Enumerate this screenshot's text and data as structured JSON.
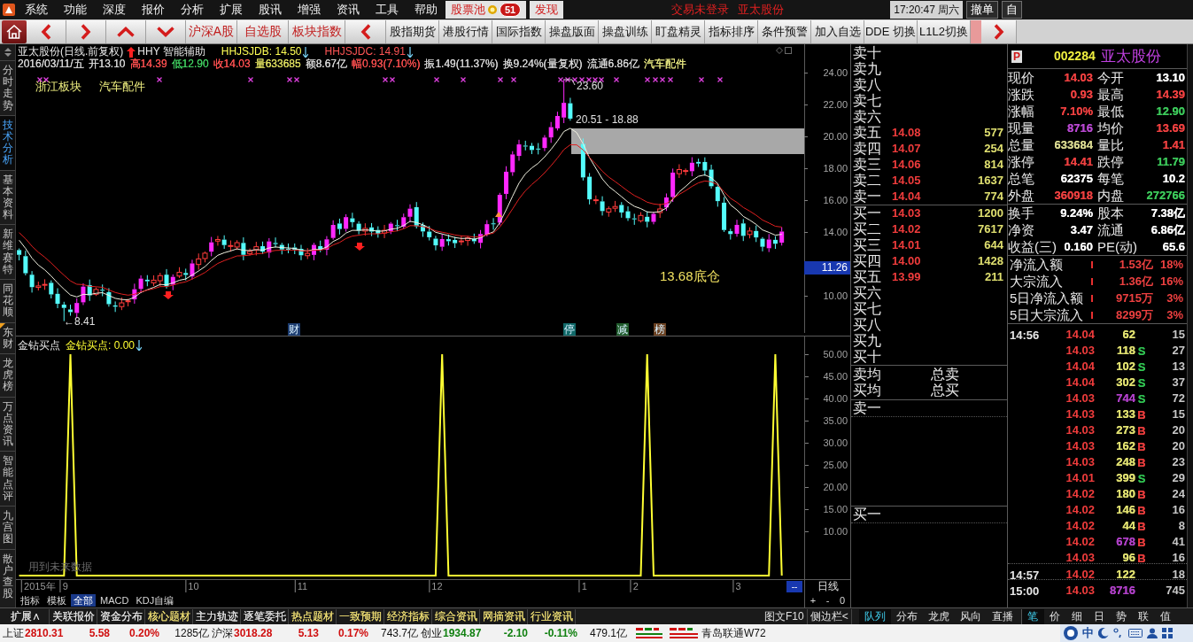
{
  "menu_bar": {
    "items": [
      "系统",
      "功能",
      "深度",
      "报价",
      "分析",
      "扩展",
      "股讯",
      "增强",
      "资讯",
      "工具",
      "帮助"
    ],
    "quick_buttons": [
      {
        "label": "股票池",
        "badge": "51"
      },
      {
        "label": "发现"
      }
    ],
    "notices": [
      "交易未登录",
      "亚太股份"
    ],
    "clock": "17:20:47 周六",
    "buttons": [
      "撤单",
      "自"
    ]
  },
  "toolbar": {
    "market_buttons": [
      "沪深A股",
      "自选股",
      "板块指数"
    ],
    "function_buttons": [
      "股指期货",
      "港股行情",
      "国际指数",
      "操盘版面",
      "操盘训练",
      "盯盘精灵",
      "指标排序",
      "条件预警",
      "加入自选",
      "DDE 切换",
      "L1L2切换"
    ]
  },
  "side_tabs": [
    {
      "label": "分时走势",
      "selected": false,
      "flagged": false
    },
    {
      "label": "技术分析",
      "selected": true,
      "flagged": false
    },
    {
      "label": "基本资料",
      "selected": false,
      "flagged": false
    },
    {
      "label": "新维赛特",
      "selected": false,
      "flagged": false
    },
    {
      "label": "同花顺",
      "selected": false,
      "flagged": false
    },
    {
      "label": "东财",
      "selected": false,
      "flagged": true
    },
    {
      "label": "龙虎榜",
      "selected": false,
      "flagged": false
    },
    {
      "label": "万点资讯",
      "selected": false,
      "flagged": false
    },
    {
      "label": "智能点评",
      "selected": false,
      "flagged": false
    },
    {
      "label": "九宫图",
      "selected": false,
      "flagged": false
    },
    {
      "label": "散户查股",
      "selected": false,
      "flagged": false
    }
  ],
  "price_chart": {
    "title": "亚太股份(日线.前复权)",
    "indicator": "HHY 智能辅助",
    "indicator_values": [
      {
        "text": "HHJSJDB: 14.50",
        "color": "#ffff55"
      },
      {
        "text": "HHJSJDC: 14.91",
        "color": "#ff5555"
      }
    ],
    "quote_line": [
      {
        "text": "2016/03/11/五",
        "color": "#d8d8d8"
      },
      {
        "text": "开13.10",
        "color": "#d8d8d8"
      },
      {
        "text": "高14.39",
        "color": "#ff5050"
      },
      {
        "text": "低12.90",
        "color": "#40d060"
      },
      {
        "text": "收14.03",
        "color": "#ff5050"
      },
      {
        "text": "量633685",
        "color": "#e0e060"
      },
      {
        "text": "额8.67亿",
        "color": "#d8d8d8"
      },
      {
        "text": "幅0.93(7.10%)",
        "color": "#ff5050"
      },
      {
        "text": "振1.49(11.37%)",
        "color": "#d8d8d8"
      },
      {
        "text": "换9.24%(量复权)",
        "color": "#d8d8d8"
      },
      {
        "text": "流通6.86亿",
        "color": "#d8d8d8"
      },
      {
        "text": "汽车配件",
        "color": "#e8e880"
      }
    ],
    "sector_tags": [
      "浙江板块",
      "汽车配件"
    ],
    "high_label": "23.60",
    "range_label": "20.51 - 18.88",
    "low_label": "←8.41",
    "note": "13.68底仓",
    "event_tags": [
      {
        "text": "财",
        "color": "#1c3c70"
      },
      {
        "text": "停",
        "color": "#106868"
      },
      {
        "text": "减",
        "color": "#1f5a2a"
      },
      {
        "text": "榜",
        "color": "#6a4020"
      }
    ],
    "price_axis": [
      "24.00",
      "22.00",
      "20.00",
      "18.00",
      "16.00",
      "14.00",
      "10.00"
    ],
    "current_price": "11.26"
  },
  "indicator_chart": {
    "reading": ": 0.00",
    "note": "用到未来数据",
    "chart_data": {
      "type": "line",
      "title": "金钻买点",
      "categories": [
        null,
        null,
        null,
        "2015年",
        null,
        null,
        null,
        "9",
        null,
        null,
        null,
        null,
        null,
        null,
        null,
        null,
        null,
        null,
        null,
        null,
        null,
        null,
        null,
        null,
        null,
        null,
        null,
        "10",
        null,
        null,
        null,
        null,
        null,
        null,
        null,
        null,
        null,
        null,
        null,
        null,
        null,
        null,
        null,
        null,
        "11",
        null,
        null,
        null,
        null,
        null,
        null,
        null,
        null,
        null,
        null,
        null,
        null,
        null,
        null,
        null,
        null,
        null,
        null,
        null,
        null,
        "12",
        null,
        null,
        null,
        null,
        null,
        null,
        null,
        null,
        null,
        null,
        null,
        null,
        null,
        null,
        null,
        null,
        null,
        null,
        null,
        null,
        null,
        null,
        "1",
        null,
        null,
        null,
        null,
        null,
        null,
        null,
        "2",
        null,
        null,
        null,
        null,
        null,
        null,
        null,
        null,
        null,
        null,
        null,
        null,
        null,
        null,
        null,
        "3",
        null,
        null,
        null,
        null,
        null,
        null,
        null,
        null,
        null,
        null
      ],
      "series": [
        {
          "name": "金钻买点",
          "color": "#ffff33",
          "values": [
            0,
            0,
            0,
            0,
            0,
            0,
            0,
            0,
            50,
            0,
            0,
            0,
            0,
            0,
            0,
            0,
            0,
            0,
            0,
            0,
            0,
            0,
            0,
            0,
            0,
            0,
            0,
            0,
            0,
            0,
            0,
            0,
            0,
            0,
            0,
            0,
            0,
            0,
            0,
            0,
            0,
            0,
            0,
            0,
            0,
            0,
            0,
            0,
            0,
            0,
            0,
            0,
            0,
            0,
            0,
            0,
            0,
            0,
            0,
            0,
            0,
            0,
            0,
            0,
            0,
            0,
            50,
            0,
            0,
            0,
            0,
            0,
            0,
            0,
            0,
            0,
            0,
            0,
            0,
            0,
            0,
            0,
            0,
            0,
            0,
            0,
            0,
            0,
            0,
            0,
            0,
            0,
            0,
            0,
            0,
            0,
            0,
            0,
            50,
            0,
            0,
            0,
            0,
            0,
            0,
            0,
            0,
            0,
            0,
            0,
            0,
            0,
            0,
            0,
            0,
            0,
            0,
            0,
            50,
            0,
            null,
            null,
            null
          ]
        }
      ],
      "ylim": [
        -1,
        54
      ],
      "yticks": [
        {
          "value": 50,
          "label": "50.00"
        },
        {
          "value": 45,
          "label": "45.00"
        },
        {
          "value": 40,
          "label": "40.00"
        },
        {
          "value": 35,
          "label": "35.00"
        },
        {
          "value": 30,
          "label": "30.00"
        },
        {
          "value": 25,
          "label": "25.00"
        },
        {
          "value": 20,
          "label": "20.00"
        },
        {
          "value": 15,
          "label": "15.00"
        },
        {
          "value": 10,
          "label": "10.00"
        }
      ]
    }
  },
  "x_axis": {
    "button": "--"
  },
  "period_label": "日线",
  "template_tabs": [
    {
      "label": "指标",
      "selected": false
    },
    {
      "label": "模板",
      "selected": false
    },
    {
      "label": "全部",
      "selected": true
    },
    {
      "label": "MACD",
      "selected": false
    },
    {
      "label": "KDJ自编",
      "selected": false
    }
  ],
  "zoom_controls": [
    "+",
    "-",
    "0"
  ],
  "order_book": {
    "asks": [
      {
        "label": "卖十"
      },
      {
        "label": "卖九"
      },
      {
        "label": "卖八"
      },
      {
        "label": "卖七"
      },
      {
        "label": "卖六"
      },
      {
        "label": "卖五",
        "price": "14.08",
        "volume": "577"
      },
      {
        "label": "卖四",
        "price": "14.07",
        "volume": "254"
      },
      {
        "label": "卖三",
        "price": "14.06",
        "volume": "814"
      },
      {
        "label": "卖二",
        "price": "14.05",
        "volume": "1637"
      },
      {
        "label": "卖一",
        "price": "14.04",
        "volume": "774"
      }
    ],
    "bids": [
      {
        "label": "买一",
        "price": "14.03",
        "volume": "1200"
      },
      {
        "label": "买二",
        "price": "14.02",
        "volume": "7617"
      },
      {
        "label": "买三",
        "price": "14.01",
        "volume": "644"
      },
      {
        "label": "买四",
        "price": "14.00",
        "volume": "1428"
      },
      {
        "label": "买五",
        "price": "13.99",
        "volume": "211"
      },
      {
        "label": "买六"
      },
      {
        "label": "买七"
      },
      {
        "label": "买八"
      },
      {
        "label": "买九"
      },
      {
        "label": "买十"
      }
    ],
    "summary": [
      {
        "label": "卖均",
        "total_label": "总卖"
      },
      {
        "label": "买均",
        "total_label": "总买"
      }
    ],
    "queues": [
      "卖一",
      "买一"
    ]
  },
  "quote": {
    "market_badge": "P",
    "code": "002284",
    "name": "亚太股份",
    "stats": [
      {
        "label": "现价",
        "value": "14.03",
        "color": "#ee4040"
      },
      {
        "label": "今开",
        "value": "13.10",
        "color": "#ffffff"
      },
      {
        "label": "涨跌",
        "value": "0.93",
        "color": "#ee4040"
      },
      {
        "label": "最高",
        "value": "14.39",
        "color": "#ee4040"
      },
      {
        "label": "涨幅",
        "value": "7.10%",
        "color": "#ee4040"
      },
      {
        "label": "最低",
        "value": "12.90",
        "color": "#3cc85a"
      },
      {
        "label": "现量",
        "value": "8716",
        "color": "#b848d0"
      },
      {
        "label": "均价",
        "value": "13.69",
        "color": "#ee4040"
      },
      {
        "label": "总量",
        "value": "633684",
        "color": "#d8d890"
      },
      {
        "label": "量比",
        "value": "1.41",
        "color": "#ee4040"
      },
      {
        "label": "涨停",
        "value": "14.41",
        "color": "#ee4040"
      },
      {
        "label": "跌停",
        "value": "11.79",
        "color": "#3cc85a"
      },
      {
        "label": "总笔",
        "value": "62375",
        "color": "#ffffff"
      },
      {
        "label": "每笔",
        "value": "10.2",
        "color": "#ffffff"
      },
      {
        "label": "外盘",
        "value": "360918",
        "color": "#ee4040"
      },
      {
        "label": "内盘",
        "value": "272766",
        "color": "#3cc85a"
      }
    ],
    "capital": [
      {
        "label": "换手",
        "value": "9.24%",
        "color": "#ffffff"
      },
      {
        "label": "股本",
        "value": "7.38亿",
        "color": "#ffffff"
      },
      {
        "label": "净资",
        "value": "3.47",
        "color": "#ffffff"
      },
      {
        "label": "流通",
        "value": "6.86亿",
        "color": "#ffffff"
      },
      {
        "label": "收益(三)",
        "value": "0.160",
        "color": "#ffffff"
      },
      {
        "label": "PE(动)",
        "value": "65.6",
        "color": "#ffffff"
      }
    ],
    "flows": [
      {
        "label": "净流入额",
        "value": "1.53亿",
        "percent": "18%"
      },
      {
        "label": "大宗流入",
        "value": "1.36亿",
        "percent": "16%"
      },
      {
        "label": "5日净流入额",
        "value": "9715万",
        "percent": "3%"
      },
      {
        "label": "5日大宗流入",
        "value": "8299万",
        "percent": "3%"
      }
    ],
    "ticks": [
      {
        "time": "14:56",
        "price": "14.04",
        "volume": {
          "text": "62",
          "color": "#e0e070"
        },
        "count": "15"
      },
      {
        "price": "14.03",
        "volume": {
          "text": "118",
          "color": "#e0e070"
        },
        "side": {
          "text": "S",
          "color": "#30c050"
        },
        "count": "27"
      },
      {
        "price": "14.04",
        "volume": {
          "text": "102",
          "color": "#e0e070"
        },
        "side": {
          "text": "S",
          "color": "#30c050"
        },
        "count": "13"
      },
      {
        "price": "14.04",
        "volume": {
          "text": "302",
          "color": "#e0e070"
        },
        "side": {
          "text": "S",
          "color": "#30c050"
        },
        "count": "37"
      },
      {
        "price": "14.03",
        "volume": {
          "text": "744",
          "color": "#b040c8"
        },
        "side": {
          "text": "S",
          "color": "#30c050"
        },
        "count": "72"
      },
      {
        "price": "14.03",
        "volume": {
          "text": "133",
          "color": "#e0e070"
        },
        "side": {
          "text": "B",
          "color": "#e83c3c"
        },
        "count": "15"
      },
      {
        "price": "14.03",
        "volume": {
          "text": "273",
          "color": "#e0e070"
        },
        "side": {
          "text": "B",
          "color": "#e83c3c"
        },
        "count": "20"
      },
      {
        "price": "14.03",
        "volume": {
          "text": "162",
          "color": "#e0e070"
        },
        "side": {
          "text": "B",
          "color": "#e83c3c"
        },
        "count": "20"
      },
      {
        "price": "14.03",
        "volume": {
          "text": "248",
          "color": "#e0e070"
        },
        "side": {
          "text": "B",
          "color": "#e83c3c"
        },
        "count": "23"
      },
      {
        "price": "14.01",
        "volume": {
          "text": "399",
          "color": "#e0e070"
        },
        "side": {
          "text": "S",
          "color": "#30c050"
        },
        "count": "29"
      },
      {
        "price": "14.02",
        "volume": {
          "text": "180",
          "color": "#e0e070"
        },
        "side": {
          "text": "B",
          "color": "#e83c3c"
        },
        "count": "24"
      },
      {
        "price": "14.02",
        "volume": {
          "text": "146",
          "color": "#e0e070"
        },
        "side": {
          "text": "B",
          "color": "#e83c3c"
        },
        "count": "16"
      },
      {
        "price": "14.02",
        "volume": {
          "text": "44",
          "color": "#e0e070"
        },
        "side": {
          "text": "B",
          "color": "#e83c3c"
        },
        "count": "8"
      },
      {
        "price": "14.02",
        "volume": {
          "text": "678",
          "color": "#b040c8"
        },
        "side": {
          "text": "B",
          "color": "#e83c3c"
        },
        "count": "41"
      },
      {
        "price": "14.03",
        "volume": {
          "text": "96",
          "color": "#e0e070"
        },
        "side": {
          "text": "B",
          "color": "#e83c3c"
        },
        "count": "16"
      },
      {
        "time": "14:57",
        "price": "14.02",
        "volume": {
          "text": "122",
          "color": "#e0e070"
        },
        "count": "18"
      },
      {
        "time": "15:00",
        "price": "14.03",
        "volume": {
          "text": "8716",
          "color": "#b040c8"
        },
        "count": "745"
      }
    ]
  },
  "bottom_tabs": [
    {
      "label": "扩展∧",
      "color": "#e0e0e0"
    },
    {
      "label": "关联报价",
      "color": "#e0e0e0"
    },
    {
      "label": "资金分布",
      "color": "#e0e0e0"
    },
    {
      "label": "核心题材",
      "color": "#e8d870"
    },
    {
      "label": "主力轨迹",
      "color": "#e0e0e0"
    },
    {
      "label": "逐笔委托",
      "color": "#e0e0e0"
    },
    {
      "label": "热点题材",
      "color": "#e8d870"
    },
    {
      "label": "一致预期",
      "color": "#e8d870"
    },
    {
      "label": "经济指标",
      "color": "#e8d870"
    },
    {
      "label": "综合资讯",
      "color": "#e8d870"
    },
    {
      "label": "网摘资讯",
      "color": "#e8d870"
    },
    {
      "label": "行业资讯",
      "color": "#e8d870"
    }
  ],
  "side_buttons": [
    "图文F10",
    "侧边栏<"
  ],
  "panel_tabs": [
    {
      "label": "队列",
      "selected": true
    },
    {
      "label": "分布",
      "selected": false
    },
    {
      "label": "龙虎",
      "selected": false
    },
    {
      "label": "风向",
      "selected": false
    },
    {
      "label": "直播",
      "selected": false
    }
  ],
  "detail_tabs": [
    {
      "label": "笔",
      "selected": true
    },
    {
      "label": "价",
      "selected": false
    },
    {
      "label": "细",
      "selected": false
    },
    {
      "label": "日",
      "selected": false
    },
    {
      "label": "势",
      "selected": false
    },
    {
      "label": "联",
      "selected": false
    },
    {
      "label": "值",
      "selected": false
    }
  ],
  "status_bar": {
    "indices": [
      {
        "name": "上证",
        "value": "2810.31",
        "change": "5.58",
        "percent": "0.20%",
        "amount": "1285亿",
        "color": "#d01010"
      },
      {
        "name": "沪深",
        "value": "3018.28",
        "change": "5.13",
        "percent": "0.17%",
        "amount": "743.7亿",
        "color": "#d01010"
      },
      {
        "name": "创业",
        "value": "1934.87",
        "change": "-2.10",
        "percent": "-0.11%",
        "amount": "479.1亿",
        "color": "#108010"
      }
    ],
    "server": "青岛联通W72",
    "ime_mode": "中"
  }
}
